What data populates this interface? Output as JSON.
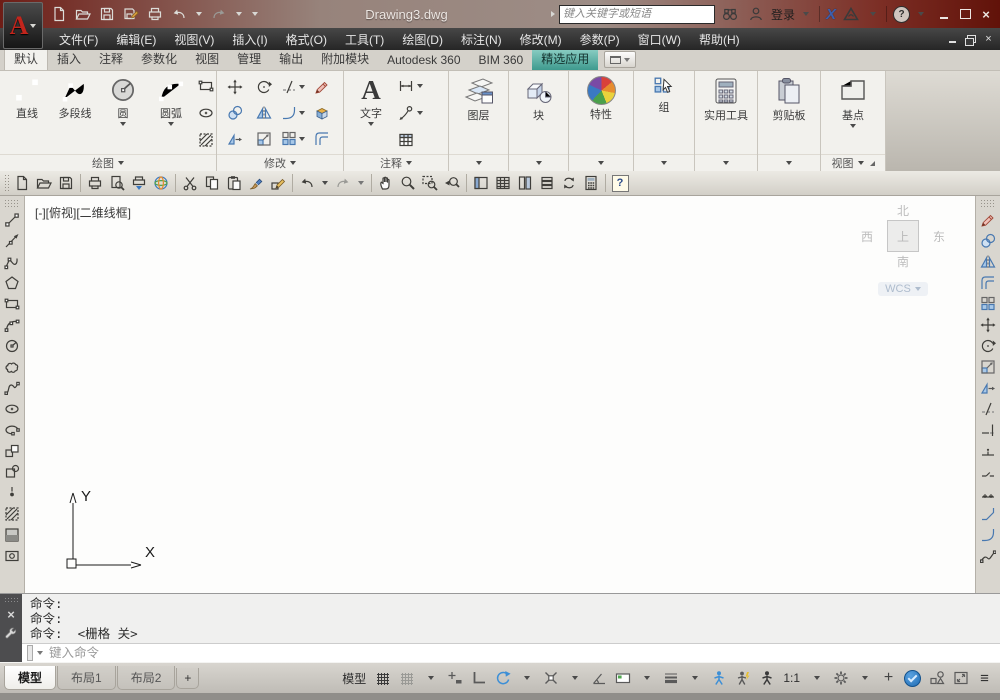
{
  "title_bar": {
    "logo_letter": "A",
    "title": "Drawing3.dwg",
    "search_placeholder": "键入关键字或短语",
    "login_label": "登录",
    "exchange_label": "X"
  },
  "glyphs": {
    "help": "?",
    "close": "×",
    "minimize": "–",
    "customize": "≡",
    "plus": "+",
    "new_layout": "+",
    "prompt": "&gt;_"
  },
  "menu_bar": {
    "items": [
      "文件(F)",
      "编辑(E)",
      "视图(V)",
      "插入(I)",
      "格式(O)",
      "工具(T)",
      "绘图(D)",
      "标注(N)",
      "修改(M)",
      "参数(P)",
      "窗口(W)",
      "帮助(H)"
    ]
  },
  "ribbon": {
    "tabs": [
      "默认",
      "插入",
      "注释",
      "参数化",
      "视图",
      "管理",
      "输出",
      "附加模块",
      "Autodesk 360",
      "BIM 360",
      "精选应用"
    ],
    "panels": {
      "draw": {
        "label": "绘图",
        "line": "直线",
        "polyline": "多段线",
        "circle": "圆",
        "arc": "圆弧"
      },
      "modify": {
        "label": "修改"
      },
      "annotate": {
        "label": "注释",
        "text": "文字"
      },
      "layers": {
        "label": "图层"
      },
      "block": {
        "label": "块"
      },
      "properties": {
        "label": "特性"
      },
      "group": {
        "label": "组"
      },
      "utilities": {
        "label": "实用工具"
      },
      "clipboard": {
        "label": "剪贴板"
      },
      "view": {
        "label": "视图",
        "base": "基点"
      }
    }
  },
  "viewport": {
    "label": "[-][俯视][二维线框]",
    "viewcube": {
      "north": "北",
      "south": "南",
      "west": "西",
      "east": "东",
      "top": "上",
      "wcs": "WCS"
    },
    "ucs": {
      "x": "X",
      "y": "Y"
    }
  },
  "command_line": {
    "lines": [
      "命令:",
      "命令:",
      "命令:  <栅格 关>"
    ],
    "input_placeholder": "键入命令"
  },
  "layout_tabs": {
    "model": "模型",
    "layout1": "布局1",
    "layout2": "布局2"
  },
  "status_bar": {
    "model_label": "模型",
    "annotation_scale": "1:1"
  }
}
